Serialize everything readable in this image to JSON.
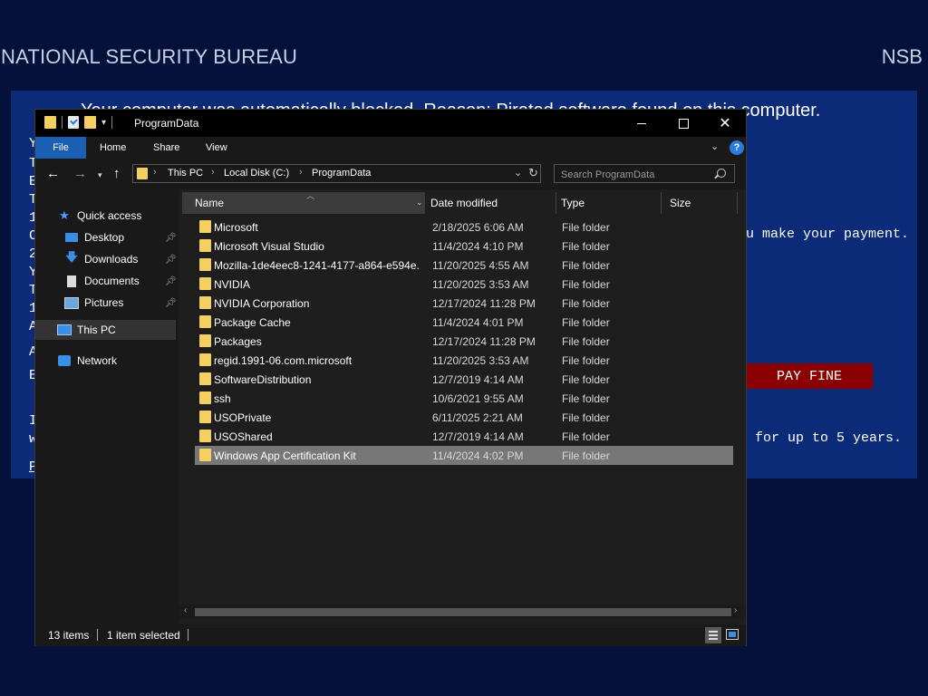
{
  "background": {
    "agency_title": "NATIONAL SECURITY BUREAU",
    "agency_abbr": "NSB",
    "headline": "Your computer was automatically blocked. Reason: Pirated software found on this computer.",
    "left_letters": [
      "Y",
      "T",
      "E",
      "T",
      "1",
      "C",
      "2",
      "Y",
      "T",
      "1",
      "A",
      "A",
      "E",
      "I",
      "w",
      "P"
    ],
    "payment_text_fragment": "u make your payment.",
    "penalty_text_fragment": "for up to 5 years.",
    "pay_button_label": "PAY FINE"
  },
  "window": {
    "title": "ProgramData",
    "ribbon_tabs": [
      "File",
      "Home",
      "Share",
      "View"
    ],
    "help_label": "?"
  },
  "address": {
    "breadcrumb": [
      "This PC",
      "Local Disk (C:)",
      "ProgramData"
    ],
    "search_placeholder": "Search ProgramData"
  },
  "nav": {
    "quick_access": "Quick access",
    "quick_items": [
      {
        "label": "Desktop",
        "icon": "desktop-icon",
        "pinned": true
      },
      {
        "label": "Downloads",
        "icon": "download-icon",
        "pinned": true
      },
      {
        "label": "Documents",
        "icon": "documents-icon",
        "pinned": true
      },
      {
        "label": "Pictures",
        "icon": "pictures-icon",
        "pinned": true
      }
    ],
    "this_pc": "This PC",
    "network": "Network",
    "selected": "This PC"
  },
  "columns": {
    "name": "Name",
    "date": "Date modified",
    "type": "Type",
    "size": "Size"
  },
  "files": [
    {
      "name": "Microsoft",
      "date": "2/18/2025 6:06 AM",
      "type": "File folder"
    },
    {
      "name": "Microsoft Visual Studio",
      "date": "11/4/2024 4:10 PM",
      "type": "File folder"
    },
    {
      "name": "Mozilla-1de4eec8-1241-4177-a864-e594e...",
      "date": "11/20/2025 4:55 AM",
      "type": "File folder"
    },
    {
      "name": "NVIDIA",
      "date": "11/20/2025 3:53 AM",
      "type": "File folder"
    },
    {
      "name": "NVIDIA Corporation",
      "date": "12/17/2024 11:28 PM",
      "type": "File folder"
    },
    {
      "name": "Package Cache",
      "date": "11/4/2024 4:01 PM",
      "type": "File folder"
    },
    {
      "name": "Packages",
      "date": "12/17/2024 11:28 PM",
      "type": "File folder"
    },
    {
      "name": "regid.1991-06.com.microsoft",
      "date": "11/20/2025 3:53 AM",
      "type": "File folder"
    },
    {
      "name": "SoftwareDistribution",
      "date": "12/7/2019 4:14 AM",
      "type": "File folder"
    },
    {
      "name": "ssh",
      "date": "10/6/2021 9:55 AM",
      "type": "File folder"
    },
    {
      "name": "USOPrivate",
      "date": "6/11/2025 2:21 AM",
      "type": "File folder"
    },
    {
      "name": "USOShared",
      "date": "12/7/2019 4:14 AM",
      "type": "File folder"
    },
    {
      "name": "Windows App Certification Kit",
      "date": "11/4/2024 4:02 PM",
      "type": "File folder",
      "selected": true
    }
  ],
  "status": {
    "item_count": "13 items",
    "selection": "1 item selected"
  },
  "colors": {
    "background": "#04113a",
    "panel": "#0b2a78",
    "pay_button": "#8b0000",
    "file_tab": "#1a5fb4",
    "folder": "#f6cf62",
    "selection": "#777777"
  }
}
